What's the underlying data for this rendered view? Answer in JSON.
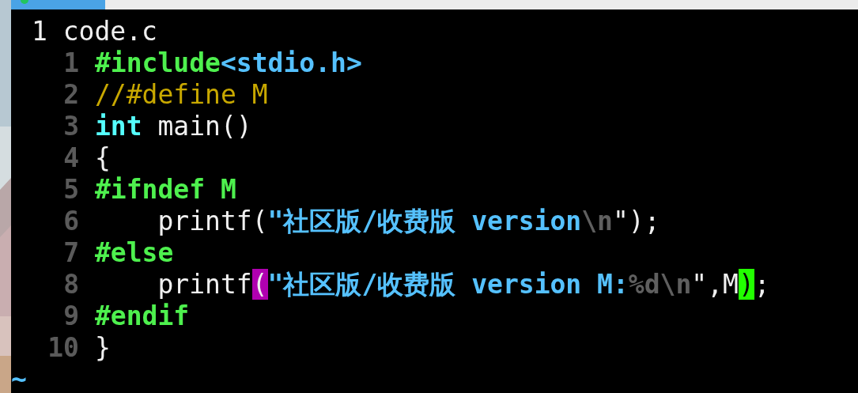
{
  "title": {
    "number": "1",
    "name": "code.c"
  },
  "lines": [
    {
      "number": "1",
      "tokens": [
        {
          "text": "#include",
          "kind": "preproc"
        },
        {
          "text": "<stdio.h>",
          "kind": "string"
        }
      ]
    },
    {
      "number": "2",
      "tokens": [
        {
          "text": "//#define M",
          "kind": "comment"
        }
      ]
    },
    {
      "number": "3",
      "tokens": [
        {
          "text": "int",
          "kind": "type"
        },
        {
          "text": " main()",
          "kind": "plain"
        }
      ]
    },
    {
      "number": "4",
      "tokens": [
        {
          "text": "{",
          "kind": "plain"
        }
      ]
    },
    {
      "number": "5",
      "tokens": [
        {
          "text": "#ifndef M",
          "kind": "preproc"
        }
      ]
    },
    {
      "number": "6",
      "tokens": [
        {
          "text": "    printf(",
          "kind": "plain"
        },
        {
          "text": "\"社区版/收费版 version",
          "kind": "string"
        },
        {
          "text": "\\n",
          "kind": "special"
        },
        {
          "text": "\");",
          "kind": "plain"
        }
      ]
    },
    {
      "number": "7",
      "tokens": [
        {
          "text": "#else",
          "kind": "preproc"
        }
      ]
    },
    {
      "number": "8",
      "tokens": [
        {
          "text": "    printf",
          "kind": "plain"
        },
        {
          "text": "(",
          "kind": "match"
        },
        {
          "text": "\"社区版/收费版 version M:",
          "kind": "string"
        },
        {
          "text": "%d\\n",
          "kind": "special"
        },
        {
          "text": "\",M",
          "kind": "plain"
        },
        {
          "text": ")",
          "kind": "cursor"
        },
        {
          "text": ";",
          "kind": "plain"
        }
      ]
    },
    {
      "number": "9",
      "tokens": [
        {
          "text": "#endif",
          "kind": "preproc"
        }
      ]
    },
    {
      "number": "10",
      "tokens": [
        {
          "text": "}",
          "kind": "plain"
        }
      ]
    }
  ],
  "filler": [
    "~"
  ]
}
